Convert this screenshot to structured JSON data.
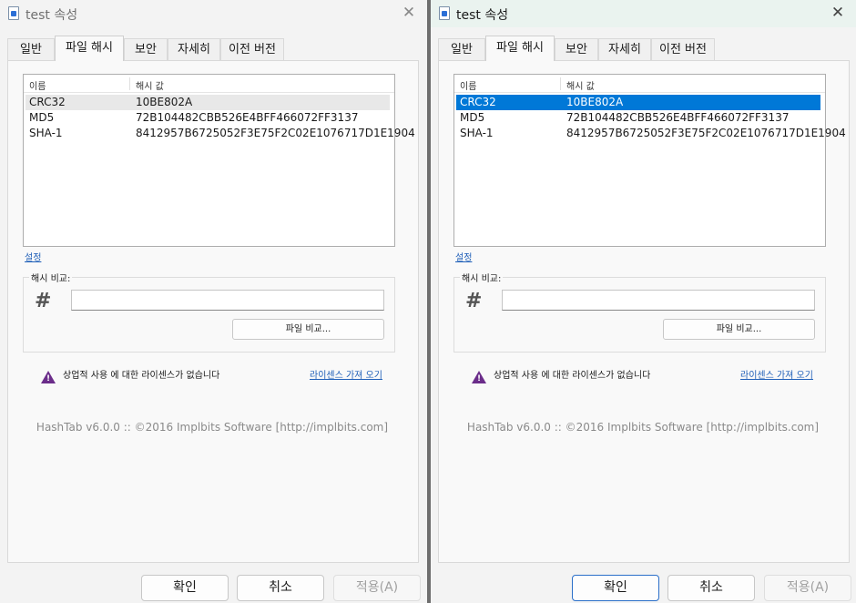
{
  "left": {
    "title": "test 속성",
    "close": "✕",
    "tabs": [
      "일반",
      "파일 해시",
      "보안",
      "자세히",
      "이전 버전"
    ],
    "list": {
      "col_name": "이름",
      "col_value": "해시 값",
      "rows": [
        {
          "name": "CRC32",
          "value": "10BE802A"
        },
        {
          "name": "MD5",
          "value": "72B104482CBB526E4BFF466072FF3137"
        },
        {
          "name": "SHA-1",
          "value": "8412957B6725052F3E75F2C02E1076717D1E1904"
        }
      ]
    },
    "settings": "설정",
    "compare_group": "해시 비교:",
    "hash_symbol": "#",
    "input_value": "",
    "file_compare": "파일 비교...",
    "license_text": "상업적 사용 에 대한 라이센스가 없습니다",
    "license_link": "라이센스 가져 오기",
    "footer": "HashTab v6.0.0 :: ©2016 Implbits Software [http://implbits.com]",
    "buttons": {
      "ok": "확인",
      "cancel": "취소",
      "apply": "적용(A)"
    }
  },
  "right": {
    "title": "test 속성",
    "close": "✕",
    "tabs": [
      "일반",
      "파일 해시",
      "보안",
      "자세히",
      "이전 버전"
    ],
    "list": {
      "col_name": "이름",
      "col_value": "해시 값",
      "rows": [
        {
          "name": "CRC32",
          "value": "10BE802A"
        },
        {
          "name": "MD5",
          "value": "72B104482CBB526E4BFF466072FF3137"
        },
        {
          "name": "SHA-1",
          "value": "8412957B6725052F3E75F2C02E1076717D1E1904"
        }
      ]
    },
    "settings": "설정",
    "compare_group": "해시 비교:",
    "hash_symbol": "#",
    "input_value": "",
    "file_compare": "파일 비교...",
    "license_text": "상업적 사용 에 대한 라이센스가 없습니다",
    "license_link": "라이센스 가져 오기",
    "footer": "HashTab v6.0.0 :: ©2016 Implbits Software [http://implbits.com]",
    "buttons": {
      "ok": "확인",
      "cancel": "취소",
      "apply": "적용(A)"
    }
  },
  "colors": {
    "selection": "#0078d7",
    "warning_icon": "#6b2d8a",
    "link": "#1f5fb8"
  },
  "icons": {
    "title": "hashtab-file-icon",
    "warning": "warning-triangle-icon",
    "hash": "hash-icon"
  }
}
